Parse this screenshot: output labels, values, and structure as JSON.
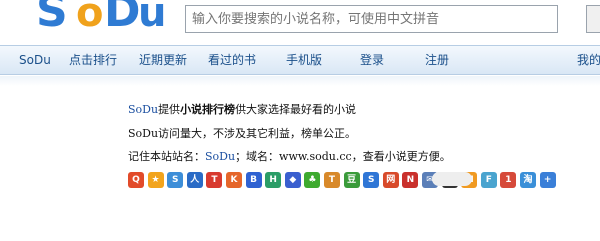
{
  "logo": {
    "letters": [
      "S",
      "o",
      "D",
      "u"
    ],
    "colors": {
      "blue": "#2f7bd3",
      "orange": "#f0a21c"
    }
  },
  "search": {
    "placeholder": "输入你要搜索的小说名称，可使用中文拼音"
  },
  "nav": {
    "items": [
      {
        "label": "SoDu"
      },
      {
        "label": "点击排行"
      },
      {
        "label": "近期更新"
      },
      {
        "label": "看过的书"
      },
      {
        "label": "手机版"
      },
      {
        "label": "登录"
      },
      {
        "label": "注册"
      },
      {
        "label": "我的"
      }
    ]
  },
  "intro": {
    "line1": {
      "brand": "SoDu",
      "part1": "提供",
      "bold": "小说排行榜",
      "part2": "供大家选择最好看的小说"
    },
    "line2": {
      "text": "SoDu访问量大，不涉及其它利益，榜单公正。"
    },
    "line3": {
      "part1": "记住本站站名：",
      "brand": "SoDu",
      "part2": "；域名：www.sodu.cc，查看小说更方便。"
    }
  },
  "share": {
    "icons": [
      {
        "name": "qzone-share-icon",
        "color": "#e24b2a",
        "glyph": "Q"
      },
      {
        "name": "favorite-share-icon",
        "color": "#f2a41d",
        "glyph": "★"
      },
      {
        "name": "sina-weibo-share-icon",
        "color": "#3d8ed8",
        "glyph": "S"
      },
      {
        "name": "renren-share-icon",
        "color": "#2a6bc6",
        "glyph": "人"
      },
      {
        "name": "tencent-weibo-share-icon",
        "color": "#d83a2f",
        "glyph": "T"
      },
      {
        "name": "kaixin-share-icon",
        "color": "#e5662a",
        "glyph": "K"
      },
      {
        "name": "baidu-share-icon",
        "color": "#2f62d2",
        "glyph": "B"
      },
      {
        "name": "hexun-share-icon",
        "color": "#2b9d67",
        "glyph": "H"
      },
      {
        "name": "baidu-space-share-icon",
        "color": "#3a5fcf",
        "glyph": "◆"
      },
      {
        "name": "clover-share-icon",
        "color": "#3eaa2f",
        "glyph": "♣"
      },
      {
        "name": "tianya-share-icon",
        "color": "#d8892a",
        "glyph": "T"
      },
      {
        "name": "douban-share-icon",
        "color": "#3a9b3a",
        "glyph": "豆"
      },
      {
        "name": "sohu-share-icon",
        "color": "#2f76d6",
        "glyph": "S"
      },
      {
        "name": "wangyi-share-icon",
        "color": "#d84a2a",
        "glyph": "网"
      },
      {
        "name": "netease-share-icon",
        "color": "#c9302c",
        "glyph": "N"
      },
      {
        "name": "email-share-icon",
        "color": "#5b7fb8",
        "glyph": "✉"
      },
      {
        "name": "qq-share-icon",
        "color": "#333333",
        "glyph": "Q"
      },
      {
        "name": "msn-share-icon",
        "color": "#f09a21",
        "glyph": "M"
      },
      {
        "name": "follow5-share-icon",
        "color": "#4aa4cf",
        "glyph": "F"
      },
      {
        "name": "163-share-icon",
        "color": "#d64a3a",
        "glyph": "1"
      },
      {
        "name": "taobao-share-icon",
        "color": "#3a8fd8",
        "glyph": "淘"
      },
      {
        "name": "more-share-icon",
        "color": "#3a7fd8",
        "glyph": "+"
      }
    ]
  }
}
